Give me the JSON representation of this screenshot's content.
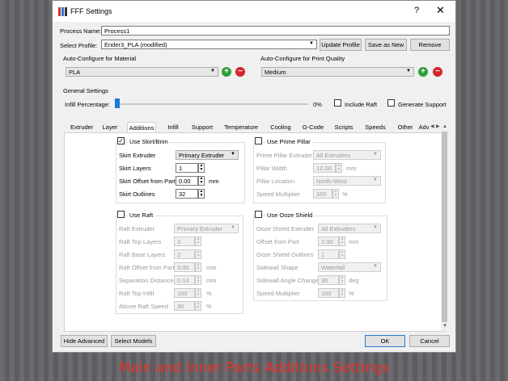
{
  "caption": "Main and Inner Parts Additions Settings",
  "window": {
    "title": "FFF Settings",
    "help": "?",
    "close": "✕"
  },
  "process_name": {
    "label": "Process Name:",
    "value": "Process1"
  },
  "select_profile": {
    "label": "Select Profile:",
    "value": "Ender3_PLA (modified)",
    "update_label": "Update Profile",
    "save_as_label": "Save as New",
    "remove_label": "Remove"
  },
  "material": {
    "label": "Auto-Configure for Material",
    "value": "PLA"
  },
  "quality": {
    "label": "Auto-Configure for Print Quality",
    "value": "Medium"
  },
  "general": {
    "label": "General Settings",
    "infill_label": "Infill Percentage:",
    "infill_value": "0%",
    "infill_fraction": 0,
    "include_raft": "Include Raft",
    "generate_support": "Generate Support"
  },
  "tabs": [
    "Extruder",
    "Layer",
    "Additions",
    "Infill",
    "Support",
    "Temperature",
    "Cooling",
    "G-Code",
    "Scripts",
    "Speeds",
    "Other",
    "Adv"
  ],
  "active_tab": "Additions",
  "skirt": {
    "title": "Use Skirt/Brim",
    "checked": true,
    "extruder_label": "Skirt Extruder",
    "extruder_value": "Primary Extruder",
    "layers_label": "Skirt Layers",
    "layers_value": "1",
    "offset_label": "Skirt Offset from Part",
    "offset_value": "0.00",
    "offset_unit": "mm",
    "outlines_label": "Skirt Outlines",
    "outlines_value": "32"
  },
  "pillar": {
    "title": "Use Prime Pillar",
    "extruder_label": "Prime Pillar Extruder",
    "extruder_value": "All Extruders",
    "width_label": "Pillar Width",
    "width_value": "12.00",
    "width_unit": "mm",
    "location_label": "Pillar Location",
    "location_value": "North-West",
    "speed_label": "Speed Multiplier",
    "speed_value": "100",
    "speed_unit": "%"
  },
  "raft": {
    "title": "Use Raft",
    "extruder_label": "Raft Extruder",
    "extruder_value": "Primary Extruder",
    "top_layers_label": "Raft Top Layers",
    "top_layers_value": "3",
    "base_layers_label": "Raft Base Layers",
    "base_layers_value": "2",
    "offset_label": "Raft Offset from Part",
    "offset_value": "3.00",
    "offset_unit": "mm",
    "separation_label": "Separation Distance",
    "separation_value": "0.14",
    "separation_unit": "mm",
    "top_infill_label": "Raft Top Infill",
    "top_infill_value": "100",
    "top_infill_unit": "%",
    "above_speed_label": "Above Raft Speed",
    "above_speed_value": "30",
    "above_speed_unit": "%"
  },
  "ooze": {
    "title": "Use Ooze Shield",
    "extruder_label": "Ooze Shield Extruder",
    "extruder_value": "All Extruders",
    "offset_label": "Offset from Part",
    "offset_value": "2.00",
    "offset_unit": "mm",
    "outlines_label": "Ooze Shield Outlines",
    "outlines_value": "1",
    "shape_label": "Sidewall Shape",
    "shape_value": "Waterfall",
    "angle_label": "Sidewall Angle Change",
    "angle_value": "30",
    "angle_unit": "deg",
    "speed_label": "Speed Multiplier",
    "speed_value": "100",
    "speed_unit": "%"
  },
  "footer": {
    "hide_advanced": "Hide Advanced",
    "select_models": "Select Models",
    "ok": "OK",
    "cancel": "Cancel"
  },
  "colors": {
    "accent": "#1a7ad8",
    "caption": "#e8322b",
    "add": "#2e9e3a",
    "remove": "#d4262c"
  }
}
